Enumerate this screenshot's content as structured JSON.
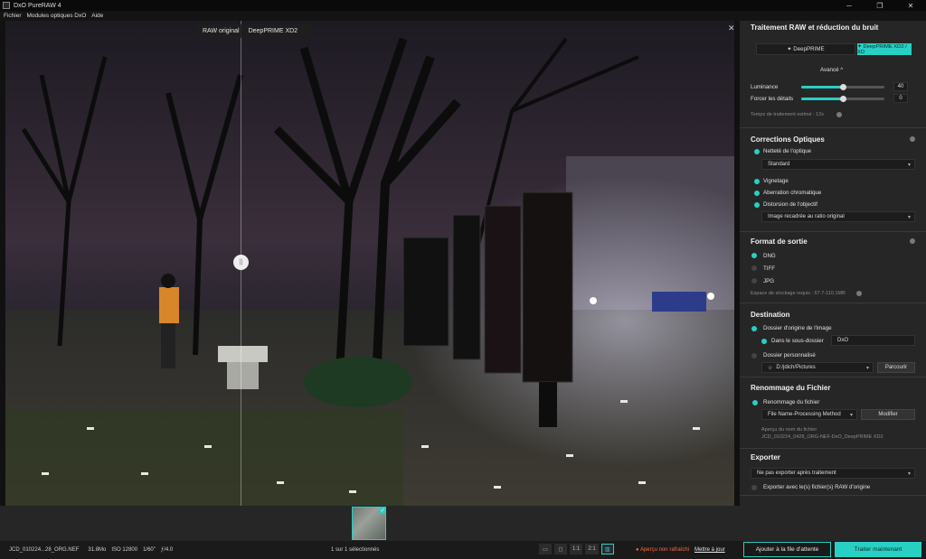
{
  "window": {
    "title": "DxO PureRAW 4"
  },
  "menu": [
    "Fichier",
    "Modules optiques DxO",
    "Aide"
  ],
  "viewer": {
    "label_original": "RAW original",
    "label_processed": "DeepPRIME XD2"
  },
  "status": {
    "filename": "JCD_010224...28_ORG.NEF",
    "size": "31.8Mo",
    "iso": "ISO 12800",
    "shutter": "1/60\"",
    "aperture": "ƒ/4.0",
    "selection": "1 sur 1 sélectionnés",
    "zoom_1": "1:1",
    "zoom_2": "2:1",
    "preview_warning": "● Aperçu non rafraîchi",
    "refresh": "Mettre à jour",
    "queue_button": "Ajouter à la file d'attente",
    "process_button": "Traiter maintenant"
  },
  "panel": {
    "denoise": {
      "title": "Traitement RAW et réduction du bruit",
      "btn1": "✦ DeepPRIME",
      "btn2": "✦ DeepPRIME XD2 / XD",
      "advanced": "Avancé ^",
      "luminance_label": "Luminance",
      "luminance_value": "40",
      "luminance_level": 0.5,
      "details_label": "Forcer les détails",
      "details_value": "0",
      "details_level": 0.5,
      "time_estimate": "Temps de traitement estimé : 12x"
    },
    "optics": {
      "title": "Corrections Optiques",
      "sharpness": "Netteté de l'optique",
      "sharpness_mode": "Standard",
      "vignetting": "Vignetage",
      "chromatic": "Aberration chromatique",
      "distortion": "Distorsion de l'objectif",
      "distortion_mode": "Image recadrée au ratio original"
    },
    "output": {
      "title": "Format de sortie",
      "dng": "DNG",
      "tiff": "TIFF",
      "jpg": "JPG",
      "storage": "Espace de stockage requis : 67.7-110.1MB"
    },
    "destination": {
      "title": "Destination",
      "origin_folder": "Dossier d'origine de l'image",
      "subfolder": "Dans le sous-dossier",
      "subfolder_value": "DxO",
      "custom_folder": "Dossier personnalisé",
      "path": "D:/jdich/Pictures",
      "browse": "Parcourir"
    },
    "rename": {
      "title": "Renommage du Fichier",
      "rename_file": "Renommage du fichier",
      "method": "File Name-Processing Method",
      "modify": "Modifier",
      "preview_label": "Aperçu du nom du fichier",
      "preview_value": "JCD_010224_0428_ORG-NEF-DxO_DeepPRIME XD2"
    },
    "export": {
      "title": "Exporter",
      "mode": "Ne pas exporter après traitement",
      "with_raw": "Exporter avec le(s) fichier(s) RAW d'origine"
    }
  },
  "colors": {
    "accent": "#27d0c3",
    "warning": "#ff6b3d"
  }
}
